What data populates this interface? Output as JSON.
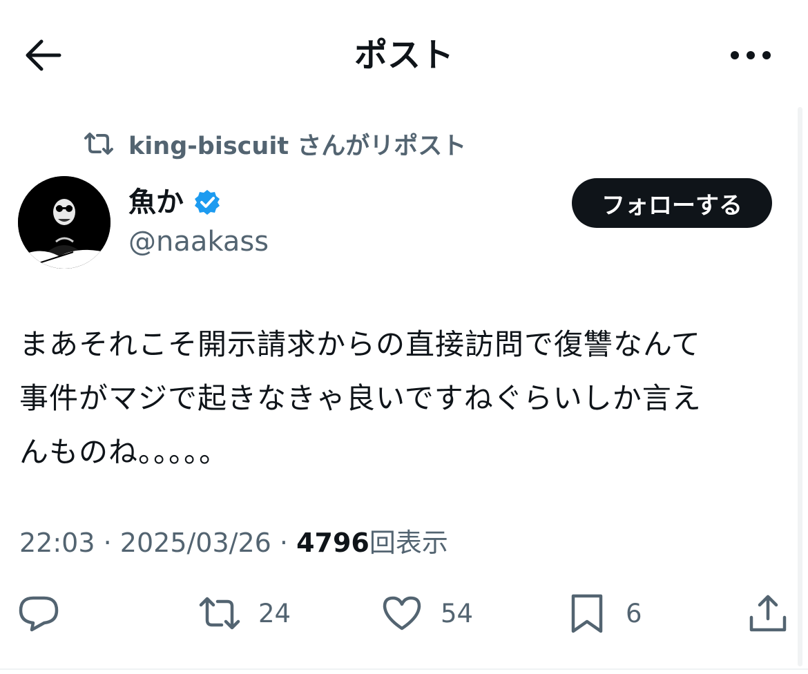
{
  "header": {
    "title": "ポスト",
    "back_icon": "arrow-left-icon",
    "more_icon": "more-horizontal-icon"
  },
  "repost": {
    "label": "king-biscuit さんがリポスト",
    "icon": "repost-icon"
  },
  "author": {
    "name": "魚か",
    "handle": "@naakass",
    "verified": true,
    "verified_color": "#1d9bf0",
    "avatar_icon": "avatar-image"
  },
  "follow_button": {
    "label": "フォローする"
  },
  "tweet": {
    "lines": [
      "まあそれこそ開示請求からの直接訪問で復讐なんて",
      "事件がマジで起きなきゃ良いですねぐらいしか言え",
      "んものね。。。。。"
    ]
  },
  "meta": {
    "time": "22:03",
    "separator": "·",
    "date": "2025/03/26",
    "views_count": "4796",
    "views_label": "回表示"
  },
  "actions": {
    "reply": {
      "icon": "reply-icon",
      "count": ""
    },
    "repost": {
      "icon": "repost-icon",
      "count": "24"
    },
    "like": {
      "icon": "heart-icon",
      "count": "54"
    },
    "bookmark": {
      "icon": "bookmark-icon",
      "count": "6"
    },
    "share": {
      "icon": "share-icon"
    }
  },
  "colors": {
    "text_primary": "#0f1419",
    "text_secondary": "#536471",
    "accent": "#1d9bf0"
  }
}
